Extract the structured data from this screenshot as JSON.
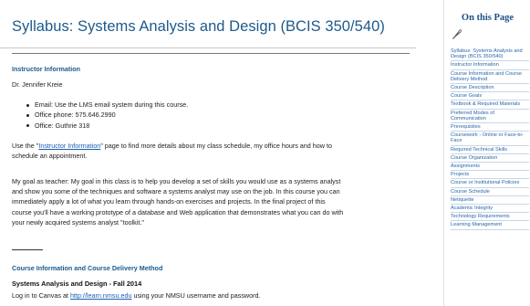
{
  "page": {
    "title": "Syllabus:  Systems Analysis and Design (BCIS 350/540)"
  },
  "instructor": {
    "heading": "Instructor Information",
    "name": "Dr. Jennifer Kreie",
    "contact": [
      "Email: Use the LMS email system during this course.",
      "Office phone: 575.646.2990",
      "Office: Guthrie 318"
    ],
    "note_before": "Use the \"",
    "note_link": "Instructor Information",
    "note_after": "\" page to find more details about my class schedule, my office hours and how to",
    "note_line2": "schedule an appointment.",
    "goal_lines": [
      "My goal as teacher: My goal in this class is to help you develop a set of skills you would use as a systems analyst",
      "and show you some of the techniques and software a systems analyst may use on the job. In this course you can",
      "immediately apply a lot of what you learn through hands-on exercises and projects. In the final project of this",
      "course you'll have a working prototype of a database and Web application that demonstrates what you can do with",
      "your newly acquired systems analyst \"toolkit.\""
    ]
  },
  "course_info": {
    "heading": "Course Information and Course Delivery Method",
    "course_name": "Systems Analysis and Design - Fall 2014",
    "login_before": "Log in to Canvas at ",
    "login_link": "http://learn.nmsu.edu",
    "login_after": " using your NMSU username and password."
  },
  "sidebar": {
    "title": "On this Page",
    "icon": "feather-quill-icon",
    "items": [
      "Syllabus:  Systems Analysis and Design (BCIS 350/540)",
      "Instructor Information",
      "Course Information and Course Delivery Method",
      "Course Description",
      "Course Goals",
      "Textbook & Required Materials",
      "Preferred Modes of Communication",
      "Prerequisites",
      "Coursework - Online or Face-to-Face",
      "Required Technical Skills",
      "Course Organization",
      "Assignments",
      "Projects",
      "Course or Institutional Policies",
      "Course Schedule",
      "Netiquette",
      "Academic Integrity",
      "Technology Requirements",
      "Learning Management"
    ]
  },
  "colors": {
    "heading": "#1d5a8c",
    "link": "#1a5fb4",
    "sidebar_link": "#2a66a8"
  }
}
